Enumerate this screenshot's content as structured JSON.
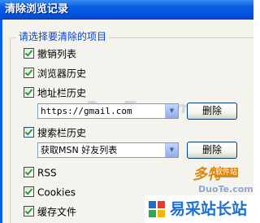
{
  "window": {
    "title": "清除浏览记录"
  },
  "group": {
    "legend": "请选择要清除的项目"
  },
  "items": {
    "undo_list": {
      "label": "撤销列表",
      "checked": true
    },
    "browser_history": {
      "label": "浏览器历史",
      "checked": true
    },
    "address_bar_history": {
      "label": "地址栏历史",
      "checked": true
    },
    "search_bar_history": {
      "label": "搜索栏历史",
      "checked": true
    },
    "rss": {
      "label": "RSS",
      "checked": true
    },
    "cookies": {
      "label": "Cookies",
      "checked": true
    },
    "cache": {
      "label": "缓存文件",
      "checked": true
    }
  },
  "address_combo": {
    "value": "https://gmail.com"
  },
  "search_combo": {
    "value": "获取MSN 好友列表"
  },
  "buttons": {
    "delete_label": "删除"
  },
  "watermarks": {
    "duote": "多特",
    "duote_sub": "软件站",
    "site": "易采站长站"
  },
  "colors": {
    "title_bar": "#0054e3",
    "legend_text": "#0046d5",
    "check_mark": "#21a121",
    "site_logo": "#1c6fd0"
  }
}
